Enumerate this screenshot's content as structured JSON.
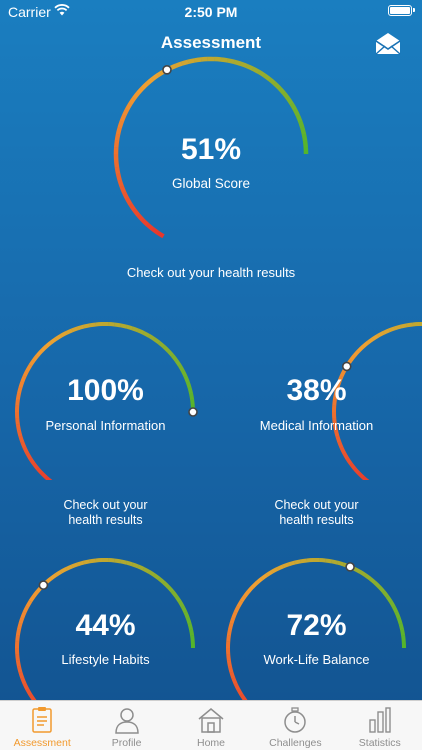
{
  "status_bar": {
    "carrier": "Carrier",
    "time": "2:50 PM"
  },
  "header": {
    "title": "Assessment",
    "mail_icon": "envelope-icon"
  },
  "colors": {
    "arc_start": "#e8352c",
    "arc_mid": "#f0a132",
    "arc_end": "#52b52c",
    "tab_active": "#f29a2e",
    "tab_inactive": "#8e8e8e"
  },
  "gauges": {
    "global": {
      "percent": 51,
      "value": "51%",
      "label": "Global Score",
      "caption": "Check out your health results"
    },
    "personal": {
      "percent": 100,
      "value": "100%",
      "label": "Personal Information",
      "caption_line1": "Check out your",
      "caption_line2": "health results"
    },
    "medical": {
      "percent": 38,
      "value": "38%",
      "label": "Medical Information",
      "caption_line1": "Check out your",
      "caption_line2": "health results"
    },
    "lifestyle": {
      "percent": 44,
      "value": "44%",
      "label": "Lifestyle Habits"
    },
    "worklife": {
      "percent": 72,
      "value": "72%",
      "label": "Work-Life Balance"
    }
  },
  "tabs": [
    {
      "label": "Assessment",
      "icon": "clipboard-icon",
      "active": true
    },
    {
      "label": "Profile",
      "icon": "person-icon",
      "active": false
    },
    {
      "label": "Home",
      "icon": "house-icon",
      "active": false
    },
    {
      "label": "Challenges",
      "icon": "stopwatch-icon",
      "active": false
    },
    {
      "label": "Statistics",
      "icon": "bar-chart-icon",
      "active": false
    }
  ]
}
